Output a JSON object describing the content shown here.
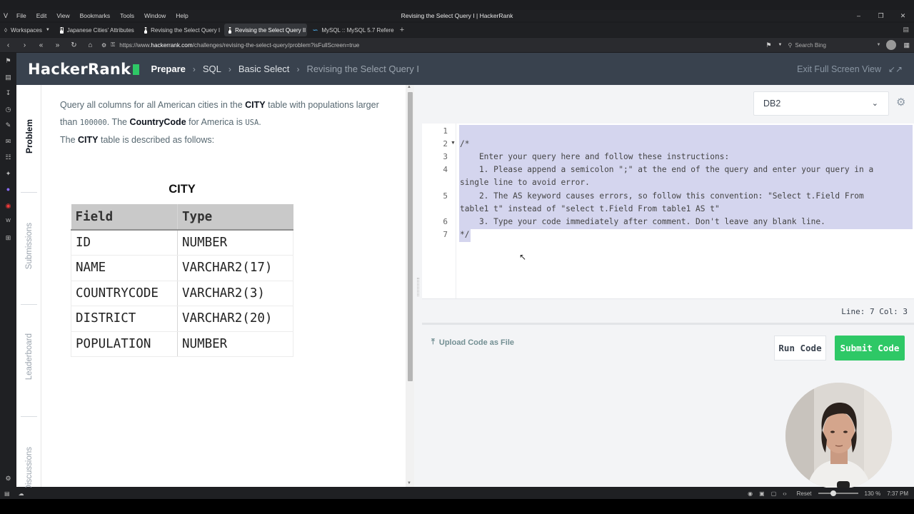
{
  "browser": {
    "window_title": "Revising the Select Query I | HackerRank",
    "menu": [
      "File",
      "Edit",
      "View",
      "Bookmarks",
      "Tools",
      "Window",
      "Help"
    ],
    "workspaces_label": "Workspaces",
    "tabs": [
      {
        "label": "Japanese Cities' Attributes",
        "icon": "hackerrank-favicon"
      },
      {
        "label": "Revising the Select Query I",
        "icon": "hackerrank-favicon"
      },
      {
        "label": "Revising the Select Query II",
        "icon": "hackerrank-favicon"
      },
      {
        "label": "MySQL :: MySQL 5.7 Refere",
        "icon": "mysql-favicon"
      }
    ],
    "url_prefix": "https://www.",
    "url_domain": "hackerrank.com",
    "url_path": "/challenges/revising-the-select-query/problem?isFullScreen=true",
    "search_placeholder": "Search Bing"
  },
  "header": {
    "logo": "HackerRank",
    "breadcrumbs": [
      "Prepare",
      "SQL",
      "Basic Select",
      "Revising the Select Query I"
    ],
    "exit_fullscreen": "Exit Full Screen View"
  },
  "rail": {
    "problem": "Problem",
    "submissions": "Submissions",
    "leaderboard": "Leaderboard",
    "discussions": "Discussions"
  },
  "problem": {
    "p1_a": "Query all columns for all American cities in the ",
    "p1_b": "CITY",
    "p1_c": " table with populations larger than ",
    "p1_d": "100000",
    "p1_e": ". The ",
    "p1_f": "CountryCode",
    "p1_g": " for America is ",
    "p1_h": "USA",
    "p1_i": ".",
    "p2_a": "The ",
    "p2_b": "CITY",
    "p2_c": " table is described as follows:",
    "table_title": "CITY",
    "table_headers": [
      "Field",
      "Type"
    ],
    "table_rows": [
      [
        "ID",
        "NUMBER"
      ],
      [
        "NAME",
        "VARCHAR2(17)"
      ],
      [
        "COUNTRYCODE",
        "VARCHAR2(3)"
      ],
      [
        "DISTRICT",
        "VARCHAR2(20)"
      ],
      [
        "POPULATION",
        "NUMBER"
      ]
    ]
  },
  "editor": {
    "language": "DB2",
    "line_numbers": [
      "1",
      "2",
      "3",
      "4",
      "5",
      "6",
      "7"
    ],
    "code_lines": [
      "/*",
      "    Enter your query here and follow these instructions:",
      "    1. Please append a semicolon \";\" at the end of the query and enter your query in a",
      "single line to avoid error.",
      "    2. The AS keyword causes errors, so follow this convention: \"Select t.Field From",
      "table1 t\" instead of \"select t.Field From table1 AS t\"",
      "    3. Type your code immediately after comment. Don't leave any blank line.",
      "*/"
    ],
    "status": "Line: 7 Col: 3"
  },
  "actions": {
    "upload": "Upload Code as File",
    "run": "Run Code",
    "submit": "Submit Code"
  },
  "statusbar": {
    "reset": "Reset",
    "zoom": "130 %",
    "time": "7:37 PM"
  },
  "colors": {
    "accent_green": "#2ec866",
    "header_bg": "#39424e",
    "selection": "#d4d5ee"
  }
}
